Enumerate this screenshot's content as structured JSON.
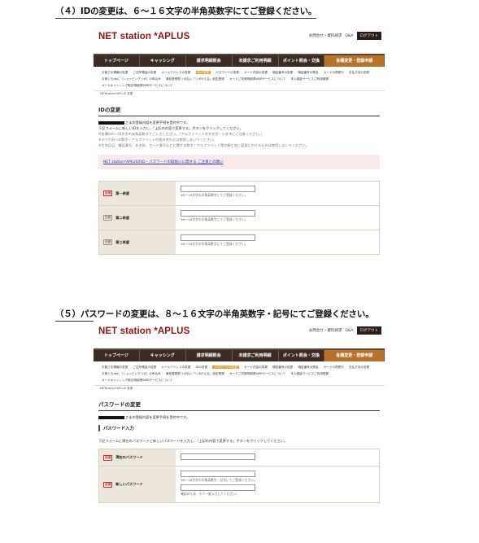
{
  "section4": {
    "heading": "（４）IDの変更は、６～１６文字の半角英数字にてご登録ください。",
    "header": {
      "logo": "NET station *APLUS",
      "links": [
        "お問合せ・資料請求",
        "Q&A",
        "ログアウト"
      ]
    },
    "nav": [
      "トップページ",
      "キャッシング",
      "請求明細照会",
      "未請求ご利用明細",
      "ポイント照会・交換",
      "各種変更・登録申請"
    ],
    "submenu": [
      "お客さま情報の変更",
      "ご住所電話の変更",
      "メールアドレスの変更",
      "IDの変更",
      "パスワードの変更",
      "カード内容の変更",
      "暗証番号の変更",
      "暗証番号の照会",
      "カードの再発行",
      "支払方法の変更",
      "お家ともdeに（ショッピングリボ）の申込み",
      "事前登録型リボ払い「リボかえ払」設定登録",
      "カードご利用明細書WEBサービスについて",
      "本人認証サービスご利用登録",
      "カードキャッシング取引明細書WEBサービスについて"
    ],
    "breadcrumb": "NETstation*APLUS 変更",
    "title": "IDの変更",
    "notice": "さまの登録内容を変更手続を受付中です。",
    "instruction": "下記フォームに新しいIDを入力し、「上記の内容で変更する」ボタンをクリックしてください。",
    "notes": [
      "※各欄の6～16文字の半角英数字でご入力ください。（アルファベットの大文字・小文字にご注意ください。）",
      "※すべて同一の数字・アルファベットの組み合わせは使用しないでください。",
      "※生年月日、電話番号、お名前、カード番号などに関する数字・アルファベット等の類と各に容易にわかるものは使用しないでください。"
    ],
    "link": "NET station*APLUSのID・パスワードの取扱いに関する ご注意との願い",
    "rows": [
      {
        "badge": "必須",
        "label": "第一希望",
        "hint": "※6～16文字の半角英数字にてご登録ください。"
      },
      {
        "badge": "任意",
        "label": "第二希望",
        "hint": "※6～16文字の半角英数字にてご登録ください。"
      },
      {
        "badge": "任意",
        "label": "第三希望",
        "hint": "※6～16文字の半角英数字にてご登録ください。"
      }
    ]
  },
  "section5": {
    "heading": "（５）パスワードの変更は、８～１６文字の半角英数字・記号にてご登録ください。",
    "header": {
      "logo": "NET station *APLUS",
      "links": [
        "お問合せ・資料請求",
        "Q&A",
        "ログアウト"
      ]
    },
    "nav": [
      "トップページ",
      "キャッシング",
      "請求明細照会",
      "未請求ご利用明細",
      "ポイント照会・交換",
      "各種変更・登録申請"
    ],
    "submenu": [
      "お客さま情報の変更",
      "ご住所電話の変更",
      "メールアドレスの変更",
      "IDの変更",
      "パスワードの変更",
      "カード内容の変更",
      "暗証番号の変更",
      "暗証番号の照会",
      "カードの再発行",
      "支払方法の変更",
      "お家ともdeに（ショッピングリボ）の申込み",
      "事前登録型リボ払い「リボかえ払」設定登録",
      "カードご利用明細書WEBサービスについて",
      "本人認証サービスご利用登録",
      "カードキャッシング取引明細書WEBサービスについて"
    ],
    "breadcrumb": "NETstation*APLUS 変更",
    "title": "パスワードの変更",
    "notice": "さまの登録内容を変更手続を受付中です。",
    "subheading": "パスワード入力",
    "instruction": "下記フォームに現在のパスワードと新しいパスワードを入力し、「上記の内容で変更する」ボタンをクリックしてください。",
    "rows": [
      {
        "badge": "必須",
        "label": "現在のパスワード",
        "hint": ""
      },
      {
        "badge": "必須",
        "label": "新しいパスワード",
        "hint": "※8～16文字の半角英数字・記号にてご登録ください。",
        "hint2": "確認のため、もう一度入力してください。"
      }
    ]
  }
}
